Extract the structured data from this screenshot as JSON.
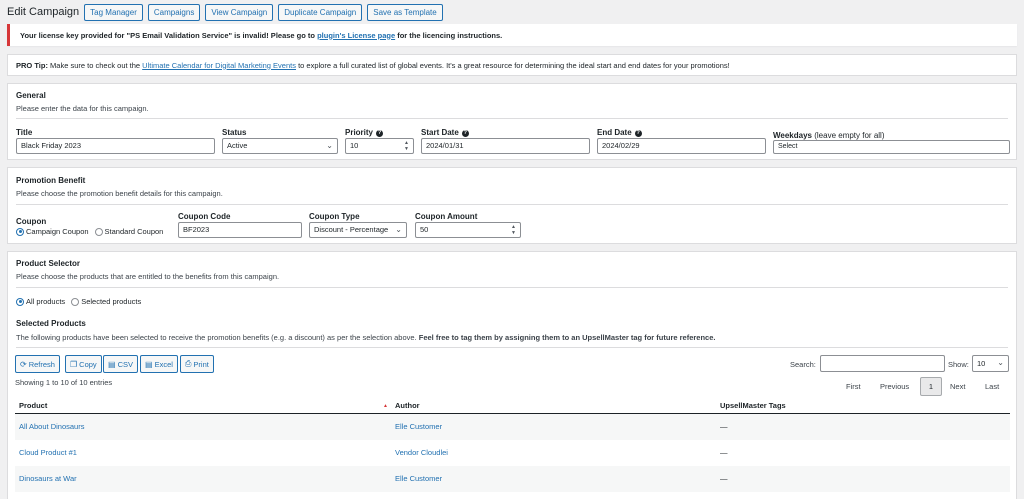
{
  "header": {
    "title": "Edit Campaign",
    "buttons": [
      "Tag Manager",
      "Campaigns",
      "View Campaign",
      "Duplicate Campaign",
      "Save as Template"
    ]
  },
  "error_notice": {
    "text_before": "Your license key provided for \"PS Email Validation Service\" is invalid! Please go to ",
    "link": "plugin's License page",
    "text_after": " for the licencing instructions."
  },
  "tip_notice": {
    "label": "PRO Tip:",
    "text_before": " Make sure to check out the ",
    "link": "Ultimate Calendar for Digital Marketing Events",
    "text_after": " to explore a full curated list of global events. It's a great resource for determining the ideal start and end dates for your promotions!"
  },
  "general": {
    "title": "General",
    "description": "Please enter the data for this campaign.",
    "title_label": "Title",
    "title_value": "Black Friday 2023",
    "status_label": "Status",
    "status_value": "Active",
    "priority_label": "Priority",
    "priority_value": "10",
    "start_label": "Start Date",
    "start_value": "2024/01/31",
    "end_label": "End Date",
    "end_value": "2024/02/29",
    "weekdays_label": "Weekdays",
    "weekdays_hint": "(leave empty for all)",
    "weekdays_placeholder": "Select"
  },
  "promotion": {
    "title": "Promotion Benefit",
    "description": "Please choose the promotion benefit details for this campaign.",
    "coupon_label": "Coupon",
    "coupon_option_campaign": "Campaign Coupon",
    "coupon_option_standard": "Standard Coupon",
    "code_label": "Coupon Code",
    "code_value": "BF2023",
    "type_label": "Coupon Type",
    "type_value": "Discount - Percentage",
    "amount_label": "Coupon Amount",
    "amount_value": "50"
  },
  "products": {
    "title": "Product Selector",
    "description": "Please choose the products that are entitled to the benefits from this campaign.",
    "option_all": "All products",
    "option_selected": "Selected products",
    "selected_title": "Selected Products",
    "selected_desc_normal": "The following products have been selected to receive the promotion benefits (e.g. a discount) as per the selection above. ",
    "selected_desc_bold": "Feel free to tag them by assigning them to an UpsellMaster tag for future reference.",
    "buttons": [
      "Refresh",
      "Copy",
      "CSV",
      "Excel",
      "Print"
    ],
    "search_label": "Search:",
    "show_label": "Show:",
    "show_value": "10",
    "info": "Showing 1 to 10 of 10 entries",
    "pager": {
      "first": "First",
      "previous": "Previous",
      "current": "1",
      "next": "Next",
      "last": "Last"
    },
    "columns": [
      "Product",
      "Author",
      "UpsellMaster Tags"
    ],
    "sort_glyph": "▲",
    "rows": [
      {
        "product": "All About Dinosaurs",
        "author": "Elle Customer",
        "tags": "—"
      },
      {
        "product": "Cloud Product #1",
        "author": "Vendor Cloudlei",
        "tags": "—"
      },
      {
        "product": "Dinosaurs at War",
        "author": "Elle Customer",
        "tags": "—"
      }
    ]
  },
  "icons": {
    "help": "question-circle-icon",
    "refresh": "refresh-icon",
    "copy": "copy-icon",
    "csv": "file-icon",
    "excel": "file-icon",
    "print": "print-icon"
  }
}
